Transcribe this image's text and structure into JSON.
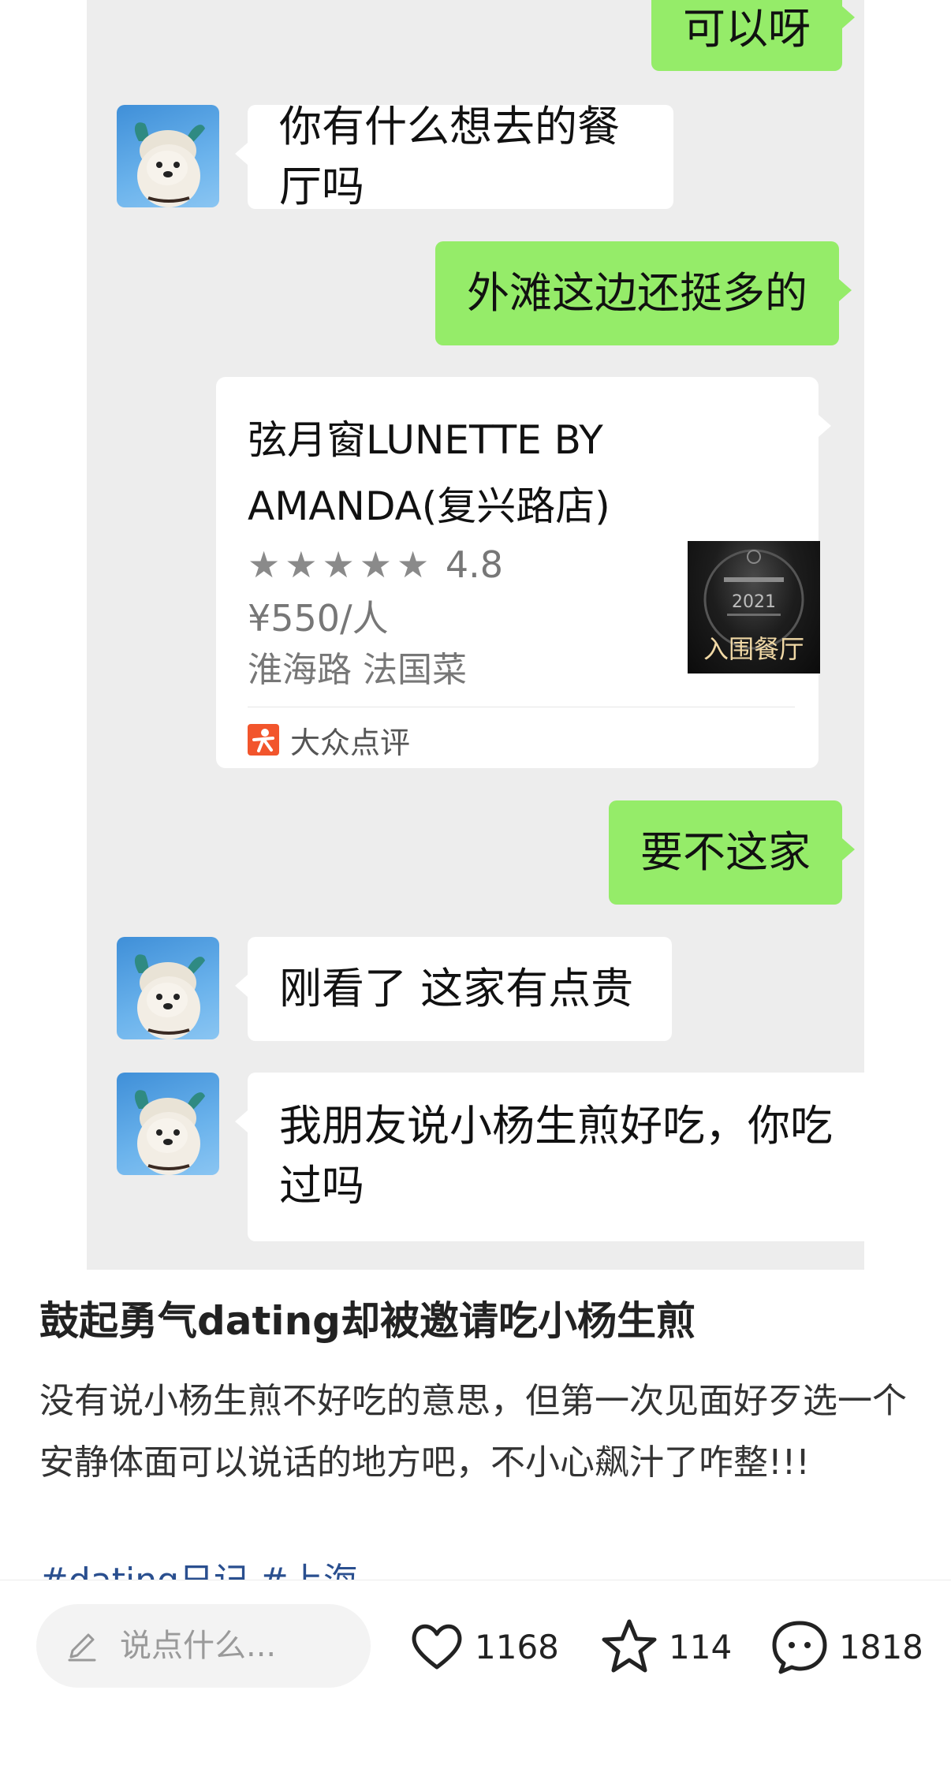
{
  "chat": {
    "messages": [
      {
        "sender": "self",
        "text": "可以呀"
      },
      {
        "sender": "other",
        "text": "你有什么想去的餐厅吗"
      },
      {
        "sender": "self",
        "text": "外滩这边还挺多的"
      },
      {
        "sender": "self",
        "type": "shared-card"
      },
      {
        "sender": "self",
        "text": "要不这家"
      },
      {
        "sender": "other",
        "text": "刚看了 这家有点贵"
      },
      {
        "sender": "other",
        "text": "我朋友说小杨生煎好吃，你吃过吗"
      }
    ],
    "card": {
      "title": "弦月窗LUNETTE BY AMANDA(复兴路店)",
      "stars": "★★★★★",
      "rating": "4.8",
      "price": "¥550/人",
      "location": "淮海路 法国菜",
      "thumb_label": "入围餐厅",
      "thumb_year": "2021",
      "source": "大众点评"
    }
  },
  "post": {
    "title": "鼓起勇气dating却被邀请吃小杨生煎",
    "body": "没有说小杨生煎不好吃的意思，但第一次见面好歹选一个安静体面可以说话的地方吧，不小心飙汁了咋整!!!",
    "tags": "#dating日记 #上海"
  },
  "bottom_bar": {
    "comment_placeholder": "说点什么...",
    "likes": "1168",
    "favorites": "114",
    "comments": "1818"
  },
  "colors": {
    "chat_background": "#ededed",
    "outgoing_bubble": "#95ec69",
    "incoming_bubble": "#ffffff",
    "tag_link": "#2a4f8f",
    "dianping_orange": "#f2552c"
  },
  "icons": [
    "pencil-icon",
    "heart-icon",
    "star-icon",
    "chat-bubble-icon",
    "dianping-logo"
  ]
}
